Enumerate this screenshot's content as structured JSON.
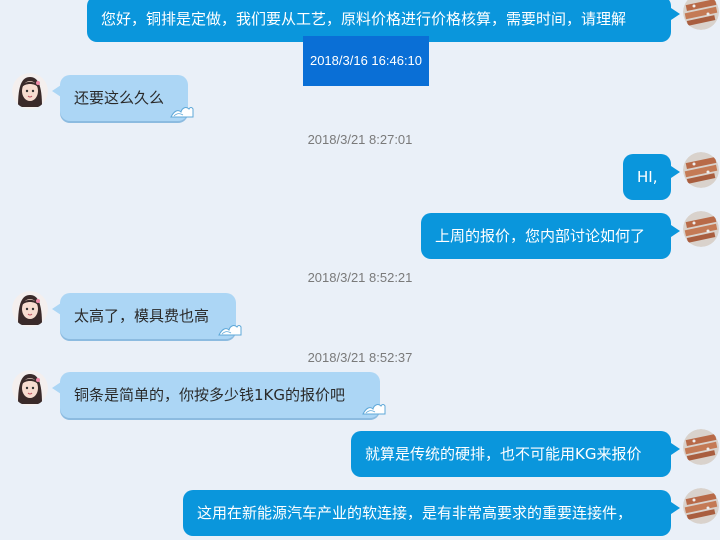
{
  "conversation": {
    "messages": [
      {
        "type": "out",
        "text": "您好，铜排是定做，我们要从工艺，原料价格进行价格核算，需要时间，请理解"
      },
      {
        "type": "timestamp",
        "text": "2018/3/16 16:46:10",
        "selected": true
      },
      {
        "type": "in",
        "text": "还要这么久么"
      },
      {
        "type": "timestamp",
        "text": "2018/3/21 8:27:01"
      },
      {
        "type": "out",
        "text": "HI,"
      },
      {
        "type": "out",
        "text": "上周的报价，您内部讨论如何了"
      },
      {
        "type": "timestamp",
        "text": "2018/3/21 8:52:21"
      },
      {
        "type": "in",
        "text": "太高了，模具费也高"
      },
      {
        "type": "timestamp",
        "text": "2018/3/21 8:52:37"
      },
      {
        "type": "in",
        "text": "铜条是简单的，你按多少钱1KG的报价吧"
      },
      {
        "type": "out",
        "text": "就算是传统的硬排，也不可能用KG来报价"
      },
      {
        "type": "out",
        "text": "这用在新能源汽车产业的软连接，是有非常高要求的重要连接件，"
      }
    ]
  },
  "colors": {
    "background": "#eaf0f8",
    "outgoing_bubble": "#0a96dc",
    "incoming_bubble": "#acd6f5",
    "timestamp_text": "#7a7a7a",
    "selection": "#0a6fd6"
  },
  "icons": {
    "user_avatar": "copper-bar-avatar-icon",
    "contact_avatar": "girl-portrait-avatar-icon",
    "bubble_decoration": "wave-icon"
  }
}
